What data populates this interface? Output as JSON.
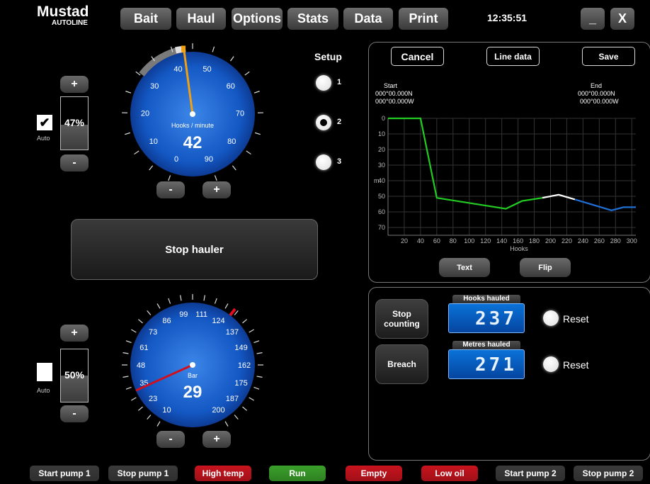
{
  "brand": {
    "name": "Mustad",
    "sub": "AUTOLINE"
  },
  "menu": [
    "Bait",
    "Haul",
    "Options",
    "Stats",
    "Data",
    "Print"
  ],
  "clock": "12:35:51",
  "window": {
    "minimize": "_",
    "close": "X"
  },
  "gauge1": {
    "label": "Hooks / minute",
    "value": "42",
    "ticks": [
      "0",
      "10",
      "20",
      "30",
      "40",
      "50",
      "60",
      "70",
      "80",
      "90"
    ],
    "max": 90,
    "needle_value": 42
  },
  "gauge2": {
    "label": "Bar",
    "value": "29",
    "ticks": [
      "10",
      "23",
      "35",
      "48",
      "61",
      "73",
      "86",
      "99",
      "111",
      "124",
      "137",
      "149",
      "162",
      "175",
      "187",
      "200"
    ],
    "needle_value": 29
  },
  "level1": {
    "percent": "47%",
    "fill": 0.47,
    "auto_label": "Auto",
    "auto_checked": true,
    "plus": "+",
    "minus": "-"
  },
  "level2": {
    "percent": "50%",
    "fill": 0.5,
    "auto_label": "Auto",
    "auto_checked": false,
    "plus": "+",
    "minus": "-"
  },
  "gauge1_controls": {
    "minus": "-",
    "plus": "+"
  },
  "gauge2_controls": {
    "minus": "-",
    "plus": "+"
  },
  "setup": {
    "title": "Setup",
    "options": [
      "1",
      "2",
      "3"
    ],
    "selected": "2"
  },
  "stop_hauler": "Stop hauler",
  "line_panel": {
    "cancel": "Cancel",
    "line_data": "Line data",
    "save": "Save",
    "start": {
      "label": "Start",
      "lat": "000°00.000N",
      "lon": "000°00.000W"
    },
    "end": {
      "label": "End",
      "lat": "000°00.000N",
      "lon": "000°00.000W"
    },
    "text_btn": "Text",
    "flip_btn": "Flip"
  },
  "chart_data": {
    "type": "line",
    "xlabel": "Hooks",
    "ylabel": "m",
    "x_ticks": [
      20,
      40,
      60,
      80,
      100,
      120,
      140,
      160,
      180,
      200,
      220,
      240,
      260,
      280,
      300
    ],
    "y_ticks": [
      0,
      10,
      20,
      30,
      40,
      50,
      60,
      70
    ],
    "xlim": [
      0,
      305
    ],
    "ylim": [
      0,
      75
    ],
    "y_inverted": true,
    "grid": true,
    "series": [
      {
        "color": "#22cc22",
        "points": [
          [
            0,
            0
          ],
          [
            40,
            0
          ],
          [
            60,
            51
          ],
          [
            145,
            58
          ],
          [
            165,
            53
          ],
          [
            190,
            51
          ]
        ]
      },
      {
        "color": "#ffffff",
        "points": [
          [
            190,
            51
          ],
          [
            210,
            49
          ],
          [
            230,
            52
          ]
        ]
      },
      {
        "color": "#1f6fd6",
        "points": [
          [
            230,
            52
          ],
          [
            275,
            59
          ],
          [
            290,
            57
          ],
          [
            305,
            57
          ]
        ]
      }
    ]
  },
  "counters": {
    "stop_counting": "Stop counting",
    "breach": "Breach",
    "hooks_label": "Hooks hauled",
    "hooks_value": "237",
    "metres_label": "Metres hauled",
    "metres_value": "271",
    "reset": "Reset"
  },
  "bottom": [
    {
      "label": "Start pump 1",
      "color": "#3a3a3a"
    },
    {
      "label": "Stop pump 1",
      "color": "#3a3a3a"
    },
    {
      "label": "High temp",
      "color": "#c8141e"
    },
    {
      "label": "Run",
      "color": "#3aa02a"
    },
    {
      "label": "Empty",
      "color": "#c8141e"
    },
    {
      "label": "Low oil",
      "color": "#c8141e"
    },
    {
      "label": "Start pump 2",
      "color": "#3a3a3a"
    },
    {
      "label": "Stop pump 2",
      "color": "#3a3a3a"
    }
  ]
}
